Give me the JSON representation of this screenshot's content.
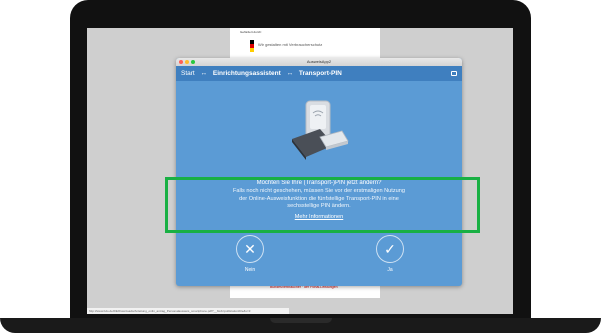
{
  "doc": {
    "logo_text": "Gefördert durch:",
    "tagline": "Wir gestalten mit Verbraucherschutz",
    "footer": "BundesVerbraucher  ·  der Portal-Leistungen",
    "url": "http://www.bdo.de/DE/Downloads/Anleitung_onlin_antrag_Personalausweis_smartphone.pdf?__blob=publicationFile&v=3"
  },
  "app": {
    "window_title": "AusweisApp2",
    "breadcrumb": [
      "Start",
      "Einrichtungsassistent",
      "Transport-PIN"
    ],
    "breadcrumb_sep": "↔",
    "question_title": "Möchten Sie Ihre (Transport-)PIN jetzt ändern?",
    "question_body_1": "Falls noch nicht geschehen, müssen Sie vor der erstmaligen Nutzung",
    "question_body_2": "der Online-Ausweisfunktion die fünfstellige Transport-PIN in eine",
    "question_body_3": "sechsstellige PIN ändern.",
    "more_info_link": "Mehr Informationen",
    "no_label": "Nein",
    "yes_label": "Ja",
    "accent_color": "#5b9bd5",
    "highlight_color": "#19b044"
  }
}
